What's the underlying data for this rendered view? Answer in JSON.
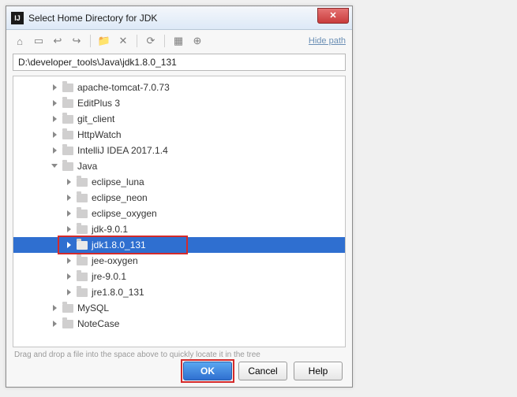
{
  "window": {
    "title": "Select Home Directory for JDK",
    "hide_path": "Hide path",
    "path_value": "D:\\developer_tools\\Java\\jdk1.8.0_131",
    "hint": "Drag and drop a file into the space above to quickly locate it in the tree"
  },
  "toolbar": {
    "home": "⌂",
    "up": "▭",
    "back": "↩",
    "forward": "↪",
    "new_folder": "📁",
    "delete": "✕",
    "refresh": "⟳",
    "show_hidden": "▦",
    "expand": "⊕"
  },
  "tree": [
    {
      "depth": 2,
      "exp": "right",
      "label": "apache-tomcat-7.0.73"
    },
    {
      "depth": 2,
      "exp": "right",
      "label": "EditPlus 3"
    },
    {
      "depth": 2,
      "exp": "right",
      "label": "git_client"
    },
    {
      "depth": 2,
      "exp": "right",
      "label": "HttpWatch"
    },
    {
      "depth": 2,
      "exp": "right",
      "label": "IntelliJ IDEA 2017.1.4"
    },
    {
      "depth": 2,
      "exp": "down",
      "label": "Java"
    },
    {
      "depth": 3,
      "exp": "right",
      "label": "eclipse_luna"
    },
    {
      "depth": 3,
      "exp": "right",
      "label": "eclipse_neon"
    },
    {
      "depth": 3,
      "exp": "right",
      "label": "eclipse_oxygen"
    },
    {
      "depth": 3,
      "exp": "right",
      "label": "jdk-9.0.1"
    },
    {
      "depth": 3,
      "exp": "right",
      "label": "jdk1.8.0_131",
      "selected": true
    },
    {
      "depth": 3,
      "exp": "right",
      "label": "jee-oxygen"
    },
    {
      "depth": 3,
      "exp": "right",
      "label": "jre-9.0.1"
    },
    {
      "depth": 3,
      "exp": "right",
      "label": "jre1.8.0_131"
    },
    {
      "depth": 2,
      "exp": "right",
      "label": "MySQL"
    },
    {
      "depth": 2,
      "exp": "right",
      "label": "NoteCase"
    }
  ],
  "buttons": {
    "ok": "OK",
    "cancel": "Cancel",
    "help": "Help"
  }
}
